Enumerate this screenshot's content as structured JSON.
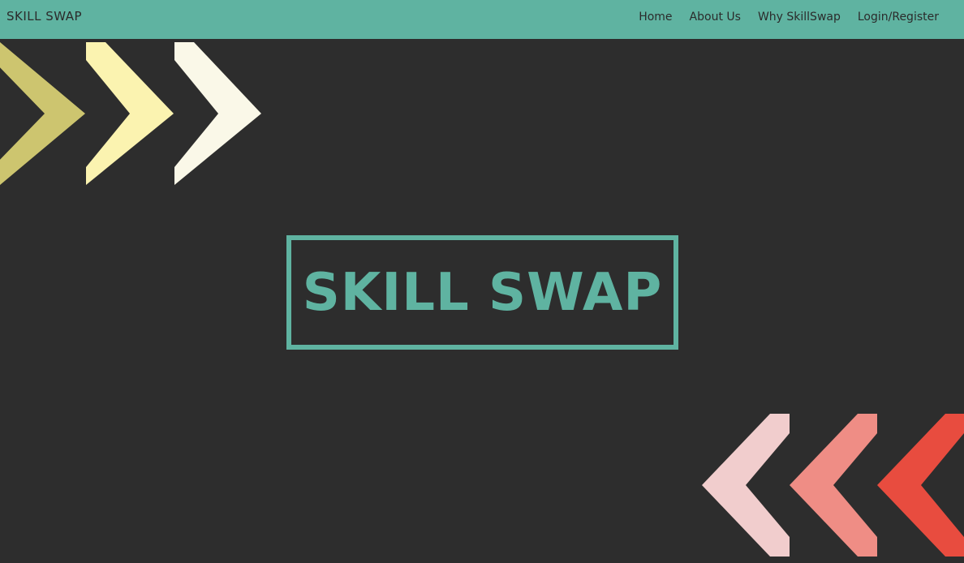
{
  "header": {
    "brand": "SKILL SWAP",
    "nav": [
      "Home",
      "About Us",
      "Why SkillSwap",
      "Login/Register"
    ]
  },
  "hero": {
    "title": "SKILL SWAP"
  },
  "colors": {
    "header_bg": "#5fb3a1",
    "page_bg": "#2d2d2d",
    "accent": "#5fb3a1",
    "chevrons_right": [
      "#cdc56f",
      "#fbf3b0",
      "#faf8e8"
    ],
    "chevrons_left": [
      "#f1cdcd",
      "#ef8d85",
      "#e84c3f"
    ]
  }
}
